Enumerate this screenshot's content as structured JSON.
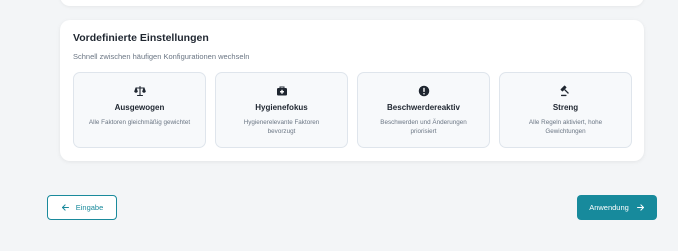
{
  "presets_section": {
    "title": "Vordefinierte Einstellungen",
    "subtitle": "Schnell zwischen häufigen Konfigurationen wechseln",
    "items": [
      {
        "icon": "scale-icon",
        "title": "Ausgewogen",
        "description": "Alle Faktoren gleichmäßig gewichtet"
      },
      {
        "icon": "medical-kit-icon",
        "title": "Hygienefokus",
        "description": "Hygienerelevante Faktoren bevorzugt"
      },
      {
        "icon": "alert-circle-icon",
        "title": "Beschwerdereaktiv",
        "description": "Beschwerden und Änderungen priorisiert"
      },
      {
        "icon": "gavel-icon",
        "title": "Streng",
        "description": "Alle Regeln aktiviert, hohe Gewichtungen"
      }
    ]
  },
  "navigation": {
    "back_label": "Eingabe",
    "next_label": "Anwendung"
  },
  "colors": {
    "accent": "#178a9c",
    "background": "#f3f5f7"
  }
}
